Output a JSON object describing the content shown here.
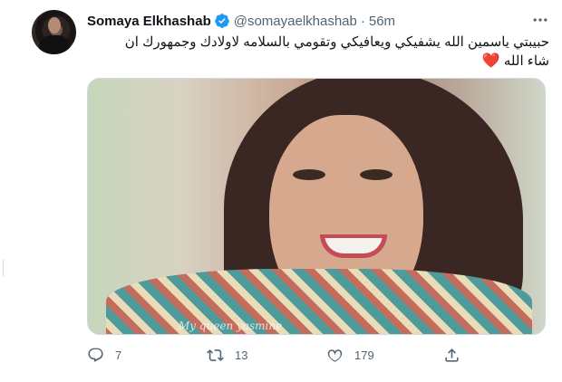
{
  "tweet": {
    "author_name": "Somaya Elkhashab",
    "handle": "@somayaelkhashab",
    "separator": "·",
    "time": "56m",
    "text_line1": "حبيبتي ياسمين الله يشفيكي ويعافيكي وتقومي بالسلامه لاولادك وجمهورك ان",
    "text_line2": "شاء الله",
    "heart_emoji": "❤️",
    "media_watermark": "My queen yasmine",
    "reply_count": "7",
    "retweet_count": "13",
    "like_count": "179"
  },
  "colors": {
    "verified": "#1d9bf0",
    "muted_text": "#536471",
    "heart": "#e0245e"
  },
  "icons": {
    "verified": "verified-badge-icon",
    "more": "more-options-icon",
    "reply": "reply-icon",
    "retweet": "retweet-icon",
    "like": "like-icon",
    "share": "share-icon"
  }
}
